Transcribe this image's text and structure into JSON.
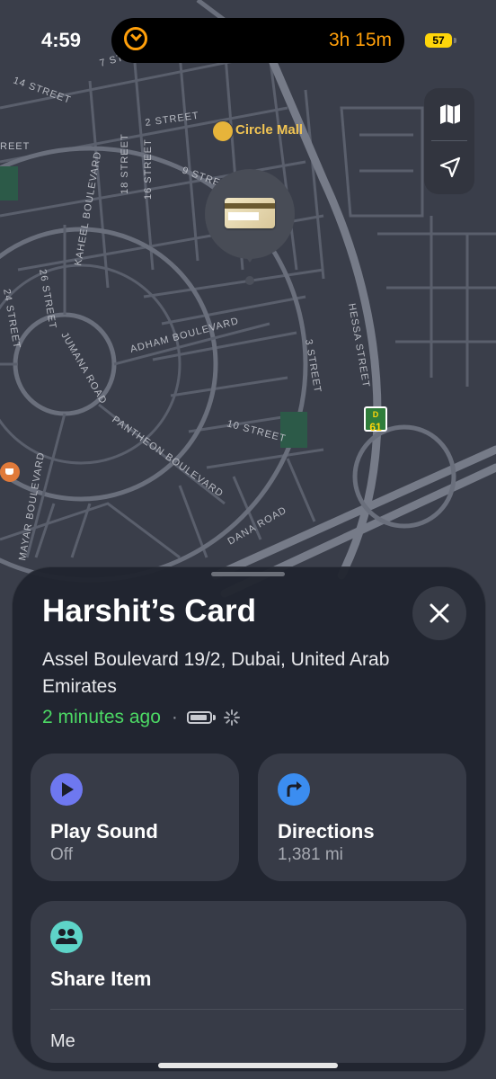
{
  "status_bar": {
    "time": "4:59",
    "timer": "3h 15m",
    "battery_level": "57",
    "accent": "#ff9f0a",
    "battery_color": "#ffd60a"
  },
  "map": {
    "map_labels": [
      "7 STREET",
      "14 STREET",
      "2 STREET",
      "REET",
      "18 STREET",
      "16 STREET",
      "9 STRE",
      "KAHEEL BOULEVARD",
      "26 STREET",
      "24 STREET",
      "JUMANA ROAD",
      "ADHAM BOULEVARD",
      "HESSA STREET",
      "3 STREET",
      "10 STREET",
      "PANTHEON BOULEVARD",
      "MAYAR BOULEVARD",
      "DANA ROAD"
    ],
    "poi_name": "Circle Mall",
    "road_badge": {
      "letter": "D",
      "number": "61"
    },
    "controls": [
      "map-icon",
      "location-arrow-icon"
    ]
  },
  "item": {
    "name": "Harshit’s Card",
    "address": "Assel Boulevard 19/2, Dubai, United Arab Emirates",
    "last_seen": "2 minutes ago",
    "separator": "·",
    "last_seen_color": "#4cd964"
  },
  "actions": {
    "play_sound": {
      "label": "Play Sound",
      "status": "Off",
      "icon": "play-icon",
      "color": "#6e78f0"
    },
    "directions": {
      "label": "Directions",
      "distance": "1,381 mi",
      "icon": "directions-arrow-icon",
      "color": "#3b8df0"
    },
    "share": {
      "label": "Share Item",
      "icon": "people-icon",
      "color": "#5ed4c8",
      "owner": "Me"
    }
  }
}
